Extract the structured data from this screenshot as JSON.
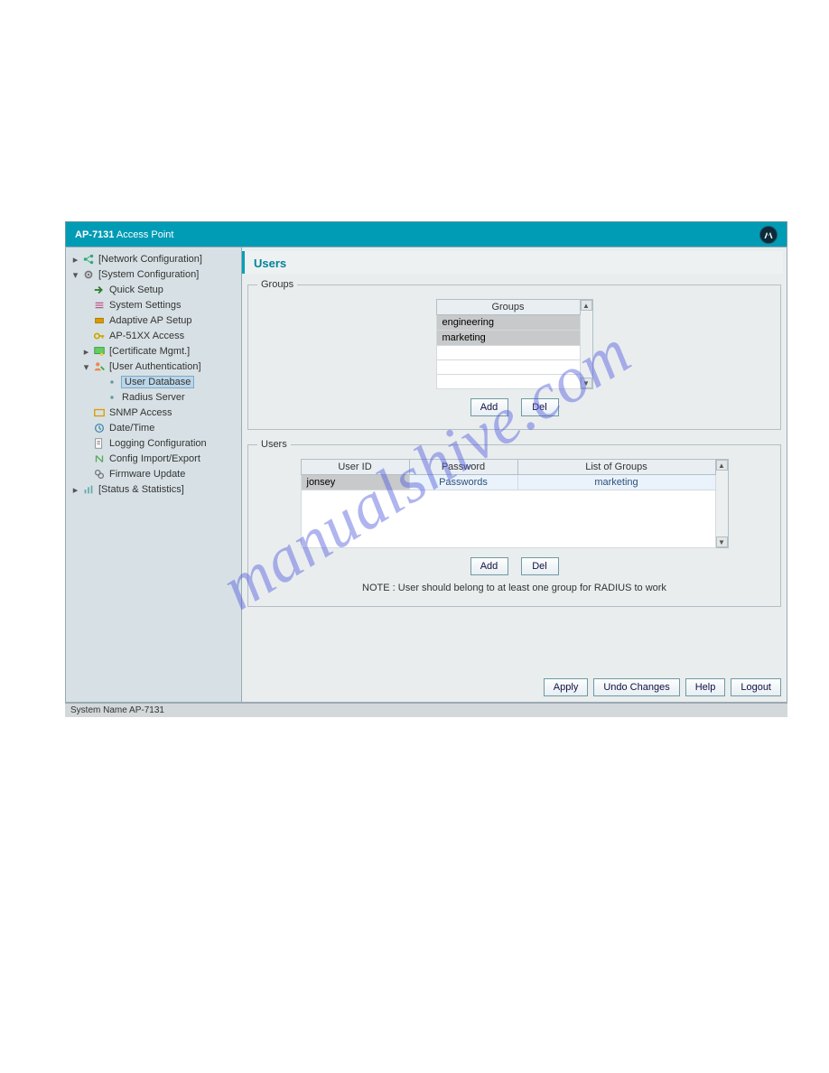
{
  "header": {
    "prefix": "AP-7131",
    "name": " Access Point"
  },
  "sidebar": {
    "net_conf": "[Network Configuration]",
    "sys_conf": "[System Configuration]",
    "quick_setup": "Quick Setup",
    "system_settings": "System Settings",
    "adaptive_ap": "Adaptive AP Setup",
    "ap51xx": "AP-51XX Access",
    "cert_mgmt": "[Certificate Mgmt.]",
    "user_auth": "[User Authentication]",
    "user_database": "User Database",
    "radius_server": "Radius Server",
    "snmp_access": "SNMP Access",
    "date_time": "Date/Time",
    "logging": "Logging Configuration",
    "config_io": "Config Import/Export",
    "firmware": "Firmware Update",
    "status_stats": "[Status & Statistics]"
  },
  "content": {
    "title": "Users",
    "groups": {
      "legend": "Groups",
      "header": "Groups",
      "rows": [
        "engineering",
        "marketing"
      ],
      "add": "Add",
      "del": "Del"
    },
    "users": {
      "legend": "Users",
      "col_userid": "User ID",
      "col_password": "Password",
      "col_groups": "List of Groups",
      "row_userid": "jonsey",
      "row_password": "Passwords",
      "row_groups": "marketing",
      "add": "Add",
      "del": "Del",
      "note": "NOTE : User should belong to at least one group for RADIUS to work"
    }
  },
  "footer": {
    "apply": "Apply",
    "undo": "Undo Changes",
    "help": "Help",
    "logout": "Logout"
  },
  "statusbar": "System Name AP-7131",
  "watermark": "manualshive.com"
}
